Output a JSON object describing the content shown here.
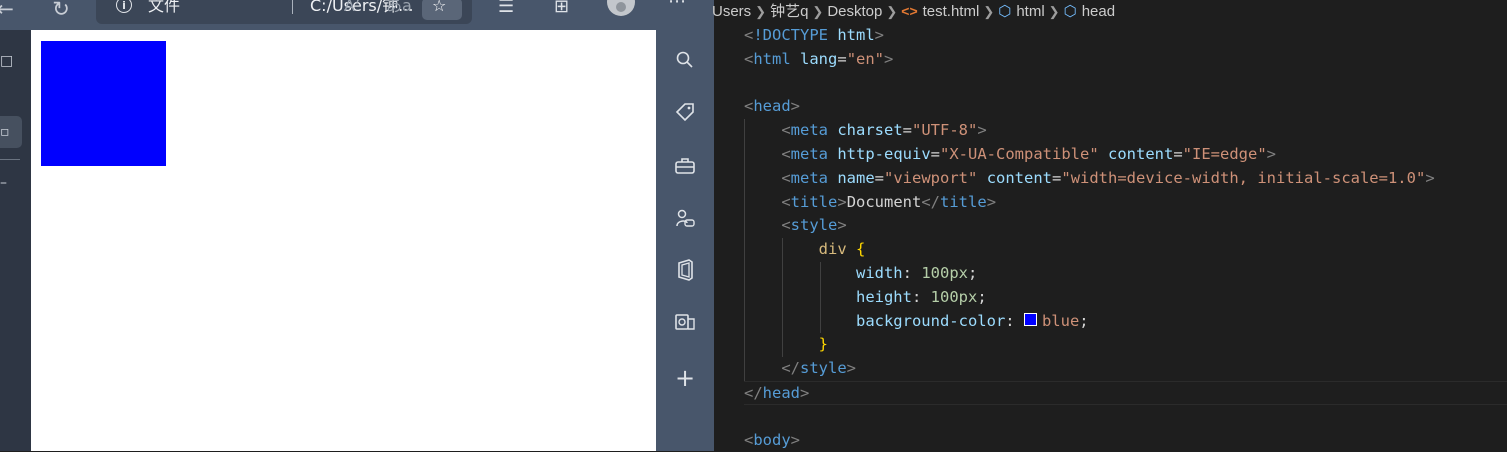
{
  "browser": {
    "address_bar": {
      "info_icon": "info-icon",
      "file_label": "文件",
      "url": "C:/Users/钟...",
      "read_aloud": "Aʼ",
      "translate": "あa"
    },
    "viewport": {
      "box_color": "#0000ff"
    }
  },
  "editor": {
    "breadcrumb": {
      "items": [
        "Users",
        "钟艺q",
        "Desktop",
        "test.html",
        "html",
        "head"
      ]
    },
    "code": {
      "doctype": "!DOCTYPE",
      "doctype_html": "html",
      "html_tag": "html",
      "lang_attr": "lang",
      "lang_val": "\"en\"",
      "head_tag": "head",
      "meta_tag": "meta",
      "charset_attr": "charset",
      "charset_val": "\"UTF-8\"",
      "http_equiv_attr": "http-equiv",
      "http_equiv_val": "\"X-UA-Compatible\"",
      "content_attr": "content",
      "content_val_1": "\"IE=edge\"",
      "name_attr": "name",
      "name_val": "\"viewport\"",
      "content_val_2": "\"width=device-width, initial-scale=1.0\"",
      "title_tag": "title",
      "title_text": "Document",
      "style_tag": "style",
      "selector": "div",
      "width_prop": "width",
      "width_val": "100px",
      "height_prop": "height",
      "height_val": "100px",
      "bg_prop": "background-color",
      "bg_val": "blue",
      "body_tag": "body",
      "swatch_color": "#0000ff"
    }
  }
}
